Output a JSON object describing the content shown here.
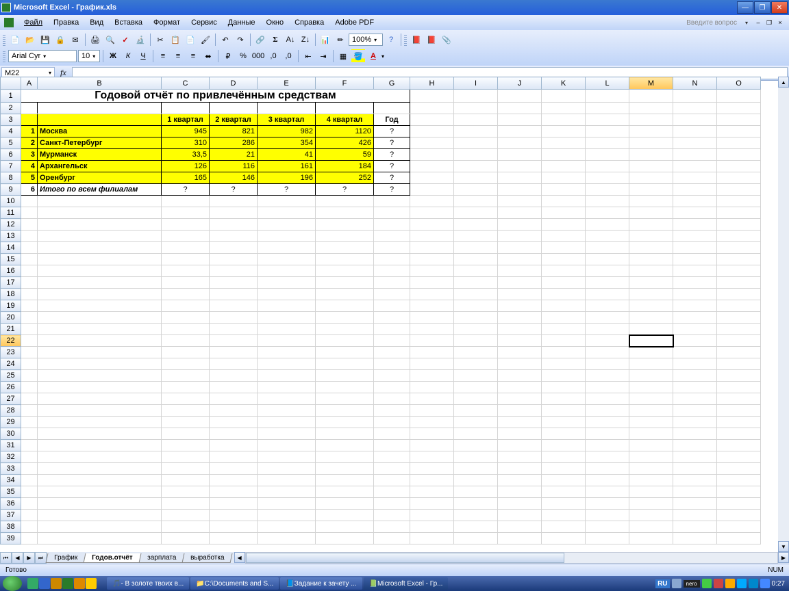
{
  "titlebar": {
    "app": "Microsoft Excel",
    "doc": "График.xls"
  },
  "menu": {
    "file": "Файл",
    "edit": "Правка",
    "view": "Вид",
    "insert": "Вставка",
    "format": "Формат",
    "service": "Сервис",
    "data": "Данные",
    "window": "Окно",
    "help": "Справка",
    "adobe": "Adobe PDF",
    "question": "Введите вопрос"
  },
  "format_bar": {
    "font": "Arial Cyr",
    "size": "10",
    "zoom": "100%"
  },
  "namebox": {
    "cell": "M22"
  },
  "sheet": {
    "title": "Годовой отчёт по привлечённым средствам",
    "headers": {
      "q1": "1 квартал",
      "q2": "2 квартал",
      "q3": "3 квартал",
      "q4": "4 квартал",
      "year": "Год"
    },
    "rows": [
      {
        "n": "1",
        "city": "Москва",
        "q1": "945",
        "q2": "821",
        "q3": "982",
        "q4": "1120",
        "y": "?"
      },
      {
        "n": "2",
        "city": "Санкт-Петербург",
        "q1": "310",
        "q2": "286",
        "q3": "354",
        "q4": "426",
        "y": "?"
      },
      {
        "n": "3",
        "city": "Мурманск",
        "q1": "33,5",
        "q2": "21",
        "q3": "41",
        "q4": "59",
        "y": "?"
      },
      {
        "n": "4",
        "city": "Архангельск",
        "q1": "126",
        "q2": "116",
        "q3": "161",
        "q4": "184",
        "y": "?"
      },
      {
        "n": "5",
        "city": "Оренбург",
        "q1": "165",
        "q2": "146",
        "q3": "196",
        "q4": "252",
        "y": "?"
      }
    ],
    "total": {
      "n": "6",
      "label": "Итого по всем филиалам",
      "q1": "?",
      "q2": "?",
      "q3": "?",
      "q4": "?",
      "y": "?"
    }
  },
  "tabs": {
    "t1": "График",
    "t2": "Годов.отчёт",
    "t3": "зарплата",
    "t4": "выработка"
  },
  "status": {
    "ready": "Готово",
    "num": "NUM"
  },
  "taskbar": {
    "items": [
      "- В золоте твоих в...",
      "C:\\Documents and S...",
      "Задание к зачету ...",
      "Microsoft Excel - Гр..."
    ],
    "lang": "RU",
    "nero": "nero",
    "time": "0:27"
  },
  "cols": [
    "A",
    "B",
    "C",
    "D",
    "E",
    "F",
    "G",
    "H",
    "I",
    "J",
    "K",
    "L",
    "M",
    "N",
    "O"
  ]
}
